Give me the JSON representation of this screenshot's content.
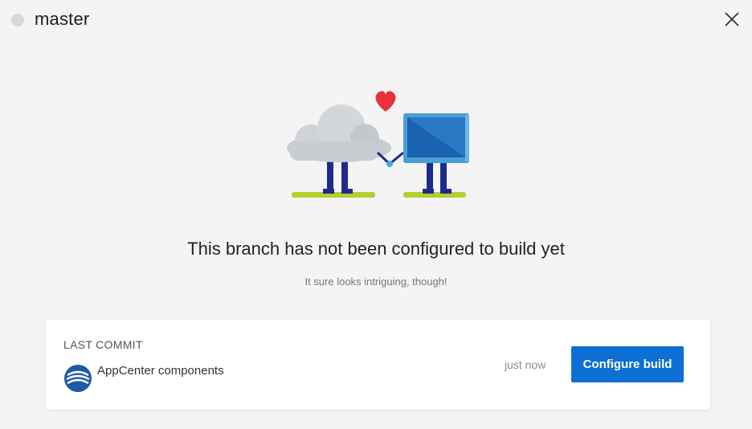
{
  "header": {
    "branch_name": "master",
    "status_dot_color": "#d8d8d8",
    "close_icon": "close-icon"
  },
  "empty_state": {
    "title": "This branch has not been configured to build yet",
    "subtitle": "It sure looks intriguing, though!",
    "illustration": "cloud-and-computer-holding-hands-with-heart"
  },
  "last_commit": {
    "label": "LAST COMMIT",
    "message": "AppCenter components",
    "time": "just now",
    "configure_label": "Configure build"
  },
  "colors": {
    "accent": "#0d6fd4",
    "background": "#f4f4f4",
    "card": "#ffffff",
    "heart": "#e8313b"
  }
}
